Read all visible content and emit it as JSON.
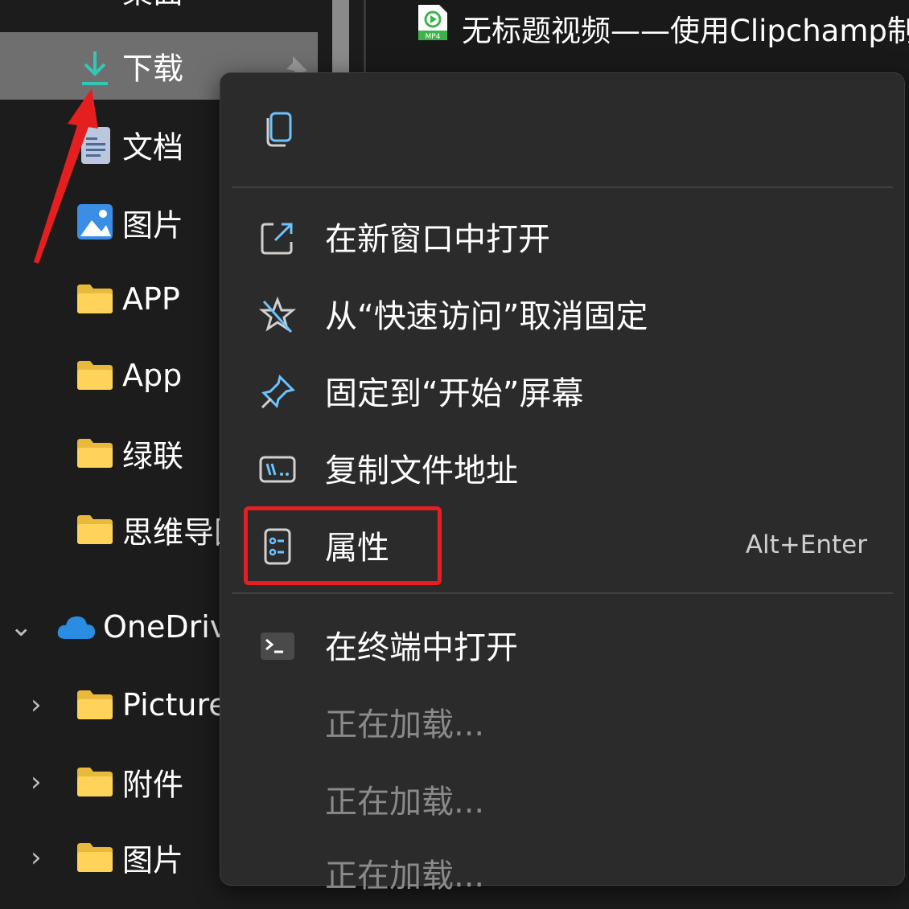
{
  "file_list": {
    "top_file_name": "无标题视频——使用Clipchamp制作",
    "top_file_badge": "MP4"
  },
  "nav": {
    "top_partial_label": "桌面",
    "items": [
      {
        "label": "下载",
        "icon": "download-icon",
        "selected": true
      },
      {
        "label": "文档",
        "icon": "document-icon"
      },
      {
        "label": "图片",
        "icon": "pictures-icon"
      },
      {
        "label": "APP",
        "icon": "folder-icon"
      },
      {
        "label": "App",
        "icon": "folder-icon"
      },
      {
        "label": "绿联",
        "icon": "folder-icon"
      },
      {
        "label": "思维导图",
        "icon": "folder-icon"
      }
    ],
    "onedrive": {
      "label": "OneDrive",
      "icon": "cloud-icon",
      "expanded": true
    },
    "onedrive_children": [
      {
        "label": "Pictures",
        "icon": "folder-icon"
      },
      {
        "label": "附件",
        "icon": "folder-icon"
      },
      {
        "label": "图片",
        "icon": "folder-icon"
      }
    ]
  },
  "context_menu": {
    "top_actions": [
      {
        "icon": "copy-icon"
      }
    ],
    "items": [
      {
        "label": "在新窗口中打开",
        "icon": "open-new-window-icon"
      },
      {
        "label": "从“快速访问”取消固定",
        "icon": "unpin-icon"
      },
      {
        "label": "固定到“开始”屏幕",
        "icon": "pin-icon"
      },
      {
        "label": "复制文件地址",
        "icon": "copy-path-icon"
      },
      {
        "label": "属性",
        "icon": "properties-icon",
        "shortcut": "Alt+Enter"
      },
      {
        "label": "在终端中打开",
        "icon": "terminal-icon"
      },
      {
        "label": "正在加载...",
        "disabled": true
      },
      {
        "label": "正在加载...",
        "disabled": true
      },
      {
        "label": "正在加载...",
        "disabled": true
      }
    ]
  },
  "colors": {
    "highlight_box": "#e51f1f",
    "annotation_arrow": "#e51f1f",
    "menu_bg": "#2b2b2b",
    "selected_nav_bg": "#6f6f6f",
    "accent": "#4cc2ff"
  }
}
